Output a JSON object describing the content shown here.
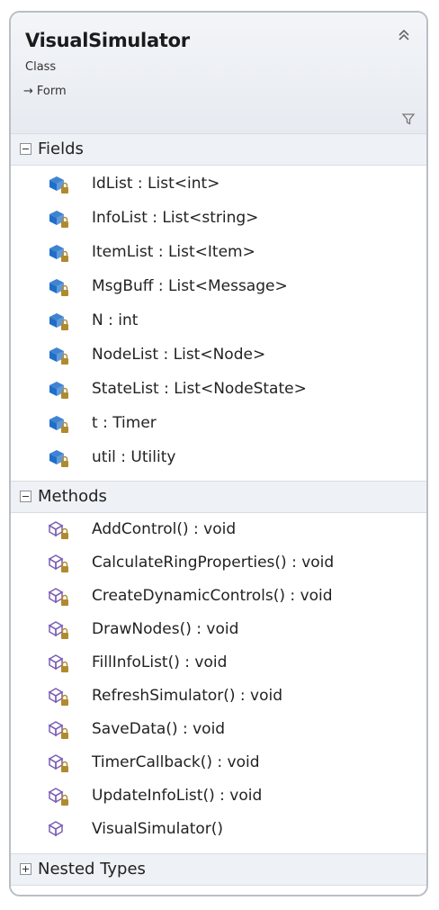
{
  "class": {
    "name": "VisualSimulator",
    "kind": "Class",
    "base_arrow": "→",
    "base": "Form"
  },
  "colors": {
    "field_icon": "#1f6fc9",
    "method_icon": "#7b5fb5",
    "lock": "#b08a2e",
    "border": "#b9bec6"
  },
  "fields": {
    "title": "Fields",
    "items": [
      {
        "label": "IdList : List<int>",
        "icon": "private-field-icon"
      },
      {
        "label": "InfoList : List<string>",
        "icon": "private-field-icon"
      },
      {
        "label": "ItemList : List<Item>",
        "icon": "private-field-icon"
      },
      {
        "label": "MsgBuff : List<Message>",
        "icon": "private-field-icon"
      },
      {
        "label": "N : int",
        "icon": "private-field-icon"
      },
      {
        "label": "NodeList : List<Node>",
        "icon": "private-field-icon"
      },
      {
        "label": "StateList : List<NodeState>",
        "icon": "private-field-icon"
      },
      {
        "label": "t : Timer",
        "icon": "private-field-icon"
      },
      {
        "label": "util : Utility",
        "icon": "private-field-icon"
      }
    ]
  },
  "methods": {
    "title": "Methods",
    "items": [
      {
        "label": "AddControl() : void",
        "icon": "private-method-icon"
      },
      {
        "label": "CalculateRingProperties() : void",
        "icon": "private-method-icon"
      },
      {
        "label": "CreateDynamicControls() : void",
        "icon": "private-method-icon"
      },
      {
        "label": "DrawNodes() : void",
        "icon": "private-method-icon"
      },
      {
        "label": "FillInfoList() : void",
        "icon": "private-method-icon"
      },
      {
        "label": "RefreshSimulator() : void",
        "icon": "private-method-icon"
      },
      {
        "label": "SaveData() : void",
        "icon": "private-method-icon"
      },
      {
        "label": "TimerCallback() : void",
        "icon": "private-method-icon"
      },
      {
        "label": "UpdateInfoList() : void",
        "icon": "private-method-icon"
      },
      {
        "label": "VisualSimulator()",
        "icon": "public-method-icon"
      }
    ]
  },
  "nested": {
    "title": "Nested Types"
  }
}
